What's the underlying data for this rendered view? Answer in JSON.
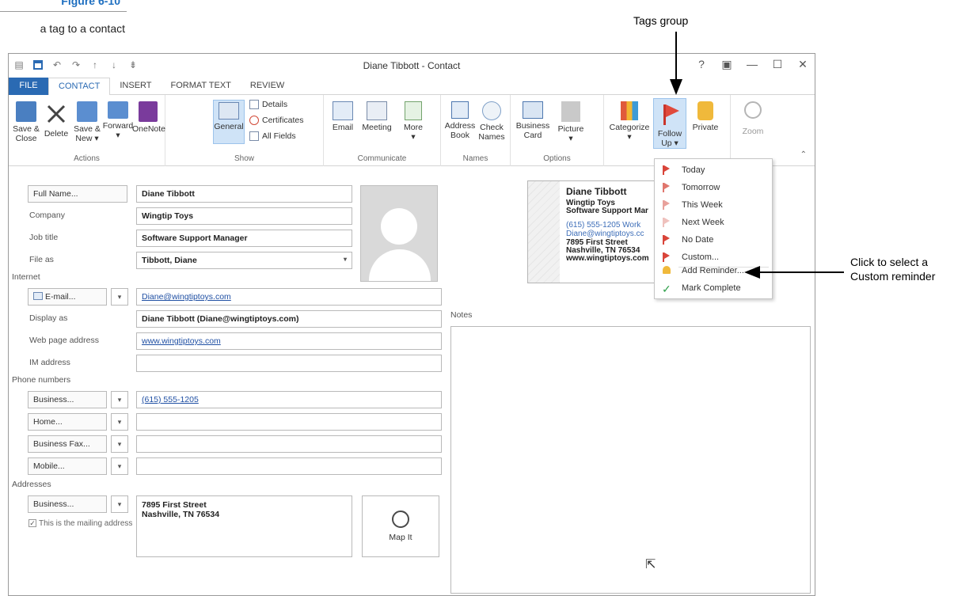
{
  "figure": {
    "number": "Figure 6-10",
    "caption": "a tag to a contact"
  },
  "callouts": {
    "tags_group": "Tags group",
    "custom_line1": "Click to select a",
    "custom_line2": "Custom reminder"
  },
  "window": {
    "title": "Diane Tibbott - Contact",
    "controls": [
      "?",
      "▣",
      "—",
      "☐",
      "✕"
    ]
  },
  "tabs": [
    "FILE",
    "CONTACT",
    "INSERT",
    "FORMAT TEXT",
    "REVIEW"
  ],
  "ribbon": {
    "actions": {
      "label": "Actions",
      "save_close": [
        "Save &",
        "Close"
      ],
      "delete": "Delete",
      "save_new": [
        "Save &",
        "New ▾"
      ],
      "forward": [
        "Forward",
        "▾"
      ],
      "onenote": "OneNote"
    },
    "show": {
      "label": "Show",
      "general": "General",
      "details": "Details",
      "certificates": "Certificates",
      "all_fields": "All Fields"
    },
    "communicate": {
      "label": "Communicate",
      "email": "Email",
      "meeting": "Meeting",
      "more": [
        "More",
        "▾"
      ]
    },
    "names": {
      "label": "Names",
      "address_book": [
        "Address",
        "Book"
      ],
      "check_names": [
        "Check",
        "Names"
      ]
    },
    "options": {
      "label": "Options",
      "business_card": [
        "Business",
        "Card"
      ],
      "picture": [
        "Picture",
        "▾"
      ]
    },
    "tags": {
      "categorize": [
        "Categorize",
        "▾"
      ],
      "follow_up": [
        "Follow",
        "Up ▾"
      ],
      "private": "Private"
    },
    "zoom": {
      "zoom": "Zoom"
    }
  },
  "form": {
    "full_name_btn": "Full Name...",
    "full_name": "Diane Tibbott",
    "company_label": "Company",
    "company": "Wingtip Toys",
    "job_title_label": "Job title",
    "job_title": "Software Support Manager",
    "file_as_label": "File as",
    "file_as": "Tibbott, Diane",
    "internet_section": "Internet",
    "email_btn": "E-mail...",
    "email": "Diane@wingtiptoys.com",
    "display_as_label": "Display as",
    "display_as": "Diane Tibbott (Diane@wingtiptoys.com)",
    "web_label": "Web page address",
    "web": "www.wingtiptoys.com",
    "im_label": "IM address",
    "im": "",
    "phone_section": "Phone numbers",
    "business_btn": "Business...",
    "business_phone": "(615) 555-1205",
    "home_btn": "Home...",
    "home_phone": "",
    "fax_btn": "Business Fax...",
    "fax": "",
    "mobile_btn": "Mobile...",
    "mobile": "",
    "addresses_section": "Addresses",
    "address_btn": "Business...",
    "address_line1": "7895 First Street",
    "address_line2": "Nashville, TN 76534",
    "mailing_checkbox": "This is the mailing address",
    "map_it": "Map It",
    "notes_label": "Notes",
    "notes": ""
  },
  "business_card": {
    "name": "Diane Tibbott",
    "company": "Wingtip Toys",
    "title": "Software Support Mar",
    "phone": "(615) 555-1205 Work",
    "email": "Diane@wingtiptoys.cc",
    "street": "7895 First Street",
    "city": "Nashville, TN 76534",
    "web": "www.wingtiptoys.com"
  },
  "follow_up_menu": {
    "items": [
      {
        "label": "Today",
        "color": "#d9453a"
      },
      {
        "label": "Tomorrow",
        "color": "#e0766d"
      },
      {
        "label": "This Week",
        "color": "#e8a19b"
      },
      {
        "label": "Next Week",
        "color": "#efc1bd"
      },
      {
        "label": "No Date",
        "color": "#d9453a"
      },
      {
        "label": "Custom...",
        "color": "#d9453a"
      }
    ],
    "add_reminder": "Add Reminder...",
    "mark_complete": "Mark Complete"
  }
}
